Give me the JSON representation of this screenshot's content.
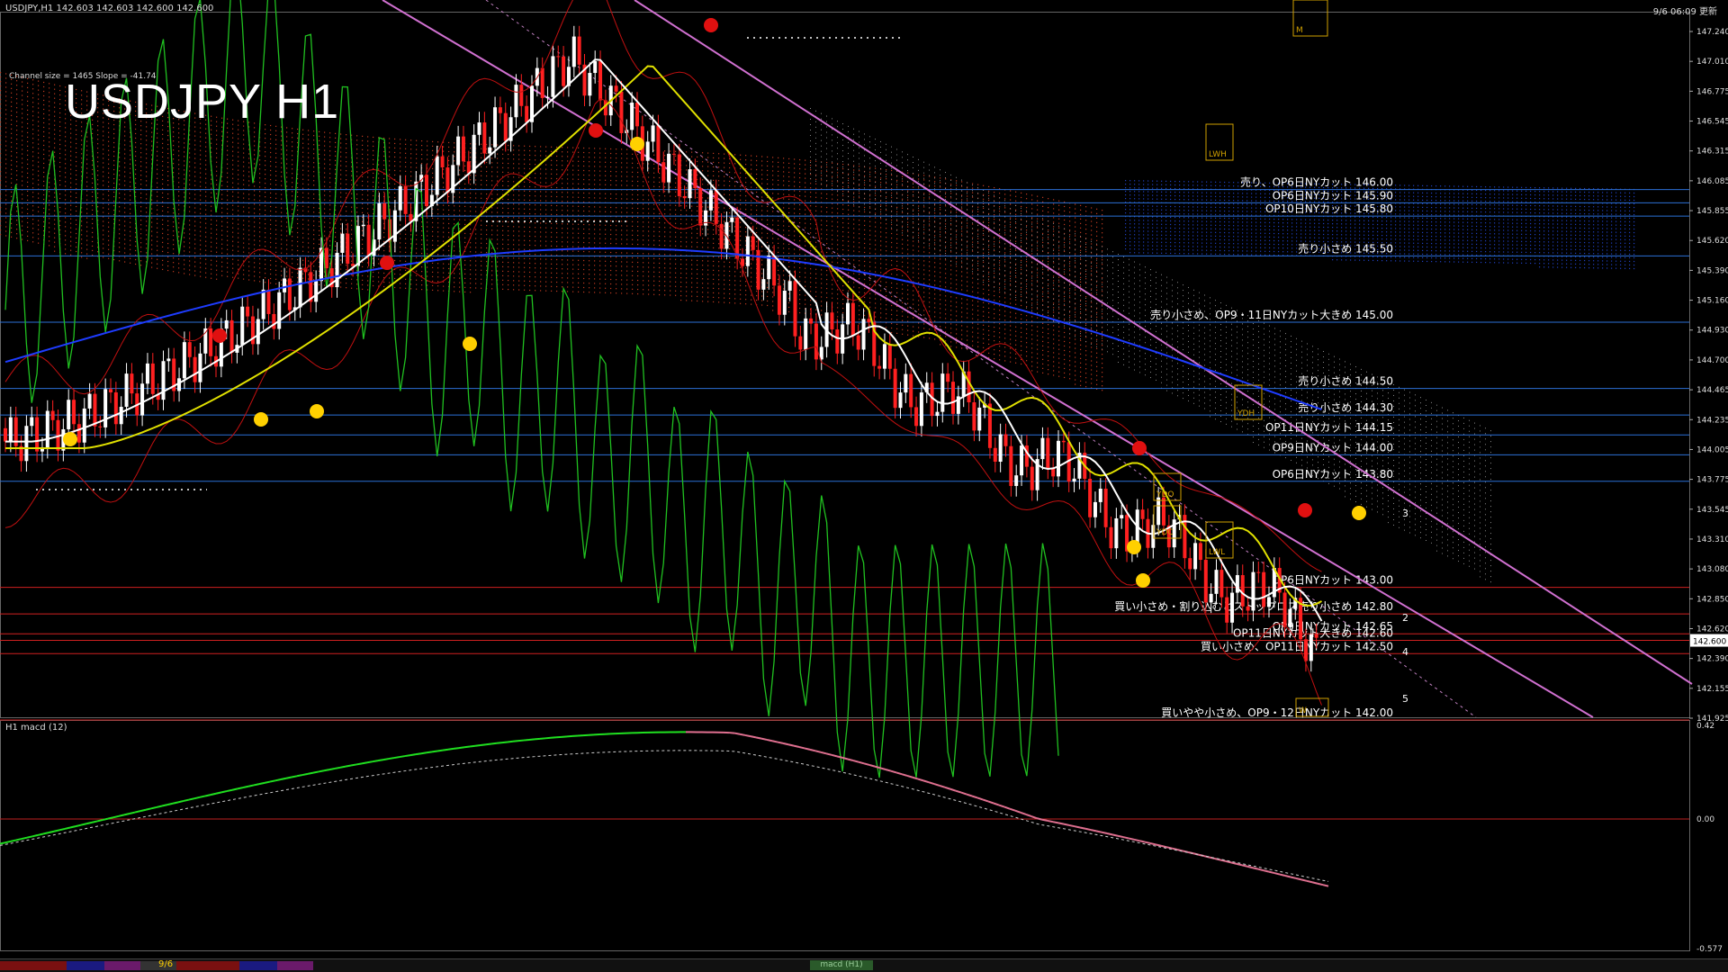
{
  "window": {
    "symbol_info": "USDJPY,H1  142.603 142.603 142.600 142.600",
    "clock": "9/6 06:09 更新",
    "title": "USDJPY H1",
    "channel_info": "Channel size = 1465 Slope = -41.74",
    "sub_window_label": "H1  macd (12)",
    "date_tag": "9/6",
    "macd_tab": "macd (H1)"
  },
  "colors": {
    "bg": "#000000",
    "bull_candle": "#ffffff",
    "bear_candle": "#ff2020",
    "level_line_blue": "#2b6fd6",
    "level_line_red": "#d02020",
    "ma_white": "#ffffff",
    "ma_yellow": "#e0e000",
    "ma_blue": "#1e3cff",
    "channel": "#d070d0",
    "bands": "#c01010",
    "cloud": "#c03a20",
    "cloud_blue": "#2040c0",
    "chikou": "#20c020",
    "macd_green": "#20e020",
    "macd_pink": "#e07090"
  },
  "price_axis": {
    "labels": [
      "147.240",
      "147.010",
      "146.775",
      "146.545",
      "146.315",
      "146.085",
      "145.855",
      "145.620",
      "145.390",
      "145.160",
      "144.930",
      "144.700",
      "144.465",
      "144.235",
      "144.005",
      "143.775",
      "143.545",
      "143.310",
      "143.080",
      "142.850",
      "142.620",
      "142.390",
      "142.155",
      "141.925"
    ],
    "current_price": "142.600"
  },
  "macd_axis": {
    "labels": [
      "0.42",
      "0.00",
      "-0.577"
    ]
  },
  "levels": [
    {
      "text": "売り、OP6日NYカット 146.00",
      "price": 146.0,
      "color": "blue"
    },
    {
      "text": "OP6日NYカット 145.90",
      "price": 145.9,
      "color": "blue"
    },
    {
      "text": "OP10日NYカット 145.80",
      "price": 145.8,
      "color": "blue"
    },
    {
      "text": "売り小さめ 145.50",
      "price": 145.5,
      "color": "blue"
    },
    {
      "text": "売り小さめ、OP9・11日NYカット大きめ 145.00",
      "price": 145.0,
      "color": "blue"
    },
    {
      "text": "売り小さめ 144.50",
      "price": 144.5,
      "color": "blue"
    },
    {
      "text": "売り小さめ 144.30",
      "price": 144.3,
      "color": "blue"
    },
    {
      "text": "OP11日NYカット 144.15",
      "price": 144.15,
      "color": "blue"
    },
    {
      "text": "OP9日NYカット 144.00",
      "price": 144.0,
      "color": "blue"
    },
    {
      "text": "OP6日NYカット 143.80",
      "price": 143.8,
      "color": "blue"
    },
    {
      "text": "OP6日NYカット 143.00",
      "price": 143.0,
      "color": "red"
    },
    {
      "text": "買い小さめ・割り込むとストップロス売り小さめ 142.80",
      "price": 142.8,
      "color": "red"
    },
    {
      "text": "OP9日NYカット 142.65",
      "price": 142.65,
      "color": "red"
    },
    {
      "text": "OP11日NYカット大きめ 142.60",
      "price": 142.6,
      "color": "red"
    },
    {
      "text": "買い小さめ、OP11日NYカット 142.50",
      "price": 142.5,
      "color": "red"
    },
    {
      "text": "買いやや小さめ、OP9・12日NYカット 142.00",
      "price": 142.0,
      "color": "red"
    }
  ],
  "wave_labels": [
    "2",
    "3",
    "4",
    "5"
  ],
  "box_labels": [
    "LWH",
    "YDH",
    "YDO",
    "YDC",
    "LWL",
    "M",
    "W"
  ]
}
